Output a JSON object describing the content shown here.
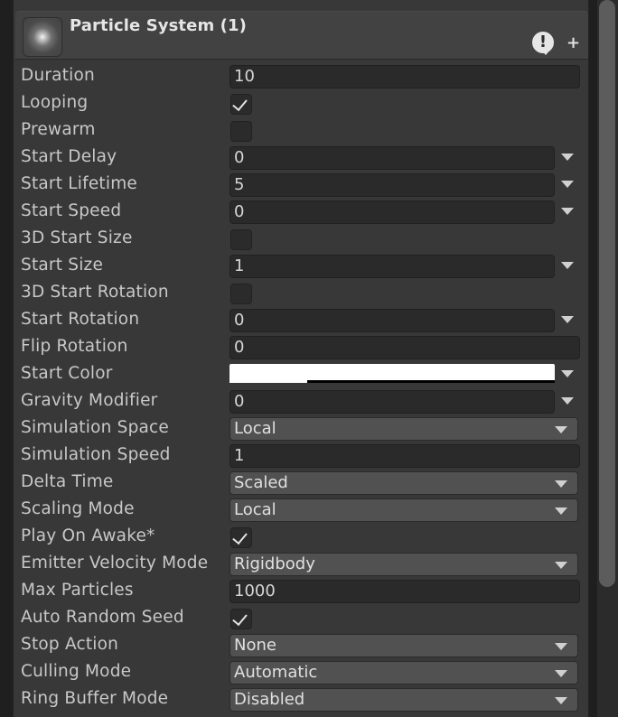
{
  "header": {
    "title": "Particle System (1)",
    "icon": "particle-system-icon",
    "help_icon": "help-icon",
    "add_icon": "plus-icon"
  },
  "fields": {
    "duration": {
      "label": "Duration",
      "value": "10"
    },
    "looping": {
      "label": "Looping",
      "checked": true
    },
    "prewarm": {
      "label": "Prewarm",
      "checked": false
    },
    "start_delay": {
      "label": "Start Delay",
      "value": "0"
    },
    "start_lifetime": {
      "label": "Start Lifetime",
      "value": "5"
    },
    "start_speed": {
      "label": "Start Speed",
      "value": "0"
    },
    "start_size_3d": {
      "label": "3D Start Size",
      "checked": false
    },
    "start_size": {
      "label": "Start Size",
      "value": "1"
    },
    "start_rotation_3d": {
      "label": "3D Start Rotation",
      "checked": false
    },
    "start_rotation": {
      "label": "Start Rotation",
      "value": "0"
    },
    "flip_rotation": {
      "label": "Flip Rotation",
      "value": "0"
    },
    "start_color": {
      "label": "Start Color",
      "color": "#ffffff"
    },
    "gravity_modifier": {
      "label": "Gravity Modifier",
      "value": "0"
    },
    "simulation_space": {
      "label": "Simulation Space",
      "value": "Local"
    },
    "simulation_speed": {
      "label": "Simulation Speed",
      "value": "1"
    },
    "delta_time": {
      "label": "Delta Time",
      "value": "Scaled"
    },
    "scaling_mode": {
      "label": "Scaling Mode",
      "value": "Local"
    },
    "play_on_awake": {
      "label": "Play On Awake*",
      "checked": true
    },
    "emitter_velocity_mode": {
      "label": "Emitter Velocity Mode",
      "value": "Rigidbody"
    },
    "max_particles": {
      "label": "Max Particles",
      "value": "1000"
    },
    "auto_random_seed": {
      "label": "Auto Random Seed",
      "checked": true
    },
    "stop_action": {
      "label": "Stop Action",
      "value": "None"
    },
    "culling_mode": {
      "label": "Culling Mode",
      "value": "Automatic"
    },
    "ring_buffer_mode": {
      "label": "Ring Buffer Mode",
      "value": "Disabled"
    }
  },
  "colors": {
    "panel": "#383838",
    "field": "#2a2a2a",
    "dropdown": "#515151",
    "text": "#c8c8c8"
  }
}
